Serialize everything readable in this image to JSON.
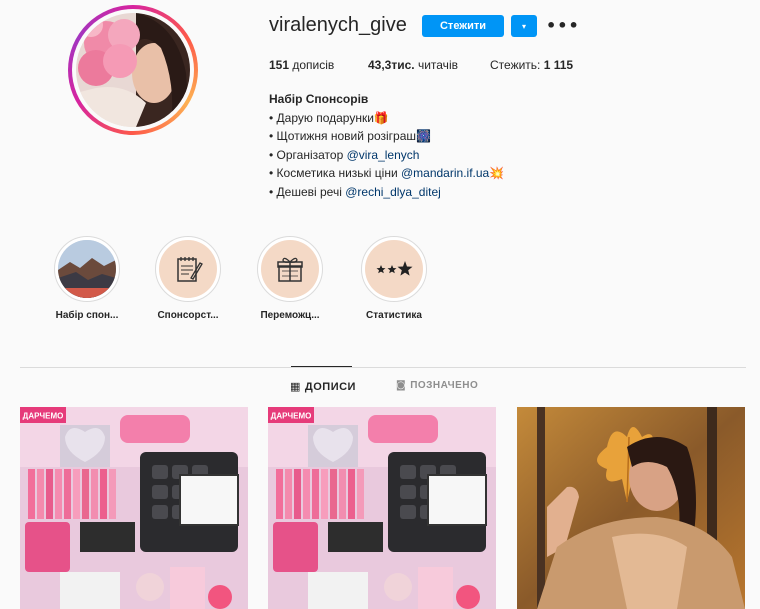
{
  "profile": {
    "username": "viralenych_give",
    "follow_label": "Стежити",
    "dropdown_icon": "▾",
    "more_icon": "•••",
    "stats": {
      "posts_count": "151",
      "posts_label": " дописів",
      "followers_count": "43,3тис.",
      "followers_label": " читачів",
      "following_label": "Стежить: ",
      "following_count": "1 115"
    },
    "bio": {
      "name": "Набір Спонсорів",
      "line1": "• Дарую подарунки🎁",
      "line2": "• Щотижня новий розіграш🎆",
      "line3_prefix": "• Організатор ",
      "line3_mention": "@vira_lenych",
      "line4_prefix": "• Косметика низькі ціни ",
      "line4_mention": "@mandarin.if.ua",
      "line4_suffix": "💥",
      "line5_prefix": "• Дешеві речі ",
      "line5_mention": "@rechi_dlya_ditej"
    }
  },
  "highlights": [
    {
      "label": "Набір спон...",
      "icon": "landscape-photo"
    },
    {
      "label": "Спонсорст...",
      "icon": "notepad-pencil-icon"
    },
    {
      "label": "Переможц...",
      "icon": "gift-icon"
    },
    {
      "label": "Статистика",
      "icon": "stars-icon"
    }
  ],
  "tabs": {
    "posts_icon": "▦",
    "posts_label": "ДОПИСИ",
    "tagged_icon": "◙",
    "tagged_label": "ПОЗНАЧЕНО"
  },
  "posts": [
    {
      "badge": "ДАРЧЕМО",
      "alt": "giveaway cosmetics set"
    },
    {
      "badge": "ДАРЧЕМО",
      "alt": "giveaway cosmetics set"
    },
    {
      "alt": "woman with autumn leaf"
    }
  ],
  "colors": {
    "accent": "#0095f6",
    "mention": "#00376b",
    "highlight_bg": "#f4d9c6"
  }
}
